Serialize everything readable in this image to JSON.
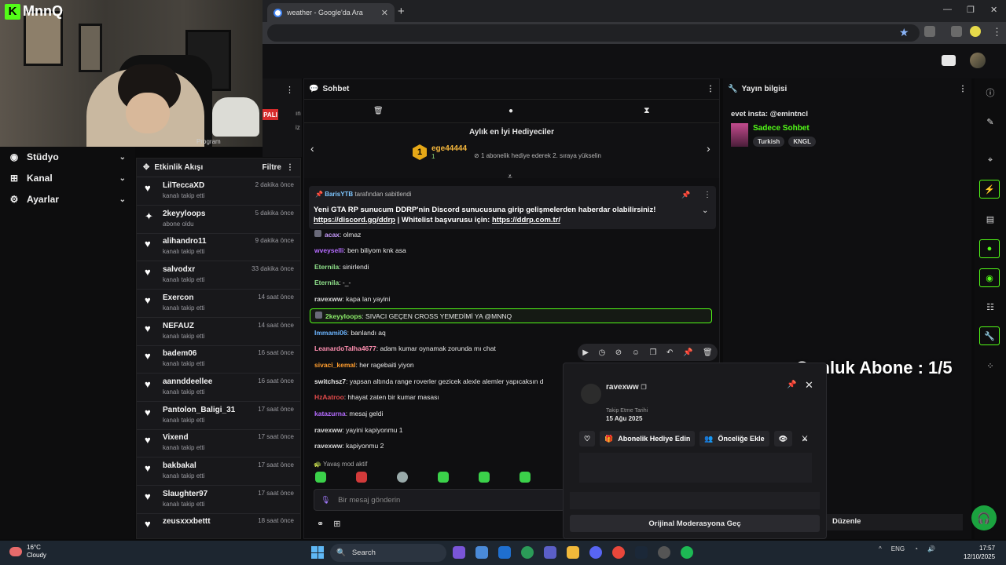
{
  "browser": {
    "tab_title": "weather - Google'da Ara",
    "new_tab": "+",
    "min": "—",
    "max": "❐",
    "close": "✕"
  },
  "webcam": {
    "brand": "MnnQ",
    "brand_letter": "K"
  },
  "partial_panel": {
    "live_badge": "PALI",
    "frag1": "Program",
    "frag2": "iz",
    "frag3": "ın"
  },
  "nav": [
    {
      "label": "Stüdyo",
      "icon": "studio-icon"
    },
    {
      "label": "Kanal",
      "icon": "channel-icon"
    },
    {
      "label": "Ayarlar",
      "icon": "settings-icon"
    }
  ],
  "activity": {
    "title": "Etkinlik Akışı",
    "filter": "Filtre",
    "items": [
      {
        "name": "LilTeccaXD",
        "action": "kanalı takip etti",
        "time": "2 dakika önce",
        "icon": "heart-icon"
      },
      {
        "name": "2keyyloops",
        "action": "abone oldu",
        "time": "5 dakika önce",
        "icon": "star-icon"
      },
      {
        "name": "alihandro11",
        "action": "kanalı takip etti",
        "time": "9 dakika önce",
        "icon": "heart-icon"
      },
      {
        "name": "salvodxr",
        "action": "kanalı takip etti",
        "time": "33 dakika önce",
        "icon": "heart-icon"
      },
      {
        "name": "Exercon",
        "action": "kanalı takip etti",
        "time": "14 saat önce",
        "icon": "heart-icon"
      },
      {
        "name": "NEFAUZ",
        "action": "kanalı takip etti",
        "time": "14 saat önce",
        "icon": "heart-icon"
      },
      {
        "name": "badem06",
        "action": "kanalı takip etti",
        "time": "16 saat önce",
        "icon": "heart-icon"
      },
      {
        "name": "aannddeellee",
        "action": "kanalı takip etti",
        "time": "16 saat önce",
        "icon": "heart-icon"
      },
      {
        "name": "Pantolon_Baligi_31",
        "action": "kanalı takip etti",
        "time": "17 saat önce",
        "icon": "heart-icon"
      },
      {
        "name": "Vixend",
        "action": "kanalı takip etti",
        "time": "17 saat önce",
        "icon": "heart-icon"
      },
      {
        "name": "bakbakal",
        "action": "kanalı takip etti",
        "time": "17 saat önce",
        "icon": "heart-icon"
      },
      {
        "name": "Slaughter97",
        "action": "kanalı takip etti",
        "time": "17 saat önce",
        "icon": "heart-icon"
      },
      {
        "name": "zeusxxxbettt",
        "action": "",
        "time": "18 saat önce",
        "icon": "heart-icon"
      }
    ]
  },
  "chat": {
    "title": "Sohbet",
    "gifters_title": "Aylık en İyi Hediyeciler",
    "top_gifter": {
      "rank": "1",
      "name": "ege44444",
      "count": "1"
    },
    "gift_note": "1 abonelik hediye ederek 2. sıraya yükselin",
    "pinned_by": "BarisYTB",
    "pinned_by_suffix": "tarafından sabitlendi",
    "pinned_line1": "Yeni GTA RP sunucum DDRP'nin Discord sunucusuna girip gelişmelerden haberdar olabilirsiniz!",
    "pinned_link1": "https://discord.gg/ddrp",
    "pinned_mid": " | Whitelist başvurusu için: ",
    "pinned_link2": "https://ddrp.com.tr/",
    "messages": [
      {
        "user": "acax",
        "text": ": olmaz",
        "color": "#c99cff"
      },
      {
        "user": "wveyselli",
        "text": ": ben biliyom knk asa",
        "color": "#b56cff"
      },
      {
        "user": "Eternila",
        "text": ": sinirlendi",
        "color": "#8fe08a"
      },
      {
        "user": "Eternila",
        "text": ": -_-",
        "color": "#8fe08a"
      },
      {
        "user": "ravexww",
        "text": ": kapa lan yayini",
        "color": "#d8d8d8"
      },
      {
        "user": "2keyyloops",
        "text": ": SIVACI GEÇEN CROSS YEMEDİMİ YA @MNNQ",
        "color": "#8ef06b"
      },
      {
        "user": "Immami06",
        "text": ": banlandı aq",
        "color": "#6cb5ff"
      },
      {
        "user": "LeanardoTalha4677",
        "text": ": adam kumar oynamak zorunda mı chat",
        "color": "#ff8fb0"
      },
      {
        "user": "sivaci_kemal",
        "text": ": her ragebaiti yiyon",
        "color": "#ff9d2e"
      },
      {
        "user": "switchsz7",
        "text": ": yapsan altında range roverler gezicek alexle alemler yapıcaksın d",
        "color": "#e8e8e8"
      },
      {
        "user": "HzAatroo",
        "text": ": hhayat zaten bir kumar masası",
        "color": "#e24a4a"
      },
      {
        "user": "katazurna",
        "text": ": mesaj geldi",
        "color": "#b56cff"
      },
      {
        "user": "ravexww",
        "text": ": yayini kapiyonmu 1",
        "color": "#d8d8d8"
      },
      {
        "user": "ravexww",
        "text": ": kapiyonmu 2",
        "color": "#d8d8d8"
      }
    ],
    "slow_mode": "Yavaş mod aktif",
    "input_placeholder": "Bir mesaj gönderin"
  },
  "user_card": {
    "username": "ravexww",
    "follow_label": "Takip Etme Tarihi",
    "follow_date": "15 Ağu 2025",
    "gift_sub": "Abonelik Hediye Edin",
    "priority": "Önceliğe Ekle",
    "mod_view": "Orijinal Moderasyona Geç"
  },
  "edit_button": "Düzenle",
  "stream_info": {
    "title": "Yayın bilgisi",
    "stream_title": "evet insta: @emintncl",
    "category": "Sadece Sohbet",
    "tags": [
      "Turkish",
      "KNGL"
    ]
  },
  "overlay": {
    "daily_subs": "Gunluk Abone : 1/5"
  },
  "taskbar": {
    "temp": "16°C",
    "weather": "Cloudy",
    "search": "Search",
    "lang": "ENG",
    "time": "17:57",
    "date": "12/10/2025"
  },
  "colors": {
    "accent": "#53fc18",
    "background": "#0f0f11"
  }
}
